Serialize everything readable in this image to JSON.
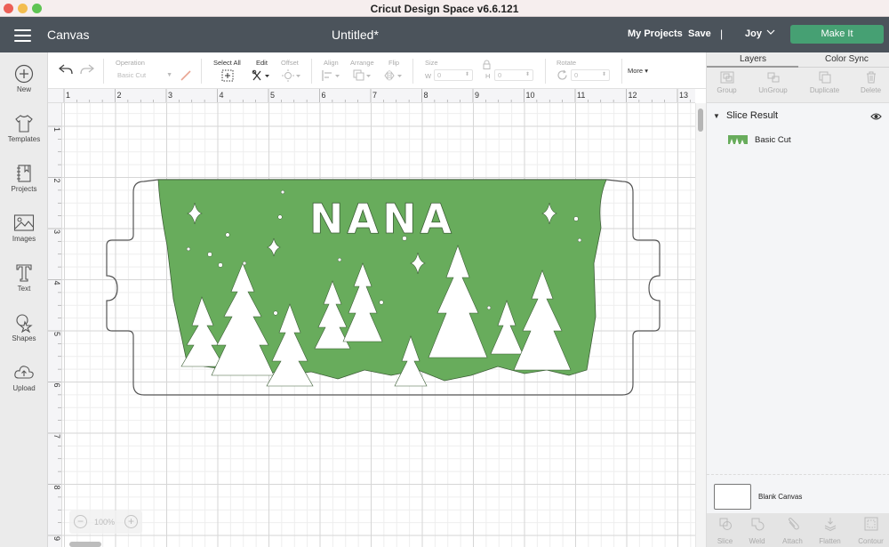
{
  "window": {
    "title": "Cricut Design Space  v6.6.121"
  },
  "header": {
    "section": "Canvas",
    "document_title": "Untitled*",
    "my_projects": "My Projects",
    "save": "Save",
    "separator": "|",
    "user": "Joy",
    "make_it": "Make It",
    "make_it_color": "#46a073"
  },
  "sidebar": {
    "items": [
      {
        "label": "New",
        "icon": "plus-circle-icon"
      },
      {
        "label": "Templates",
        "icon": "tshirt-icon"
      },
      {
        "label": "Projects",
        "icon": "notebook-icon"
      },
      {
        "label": "Images",
        "icon": "image-icon"
      },
      {
        "label": "Text",
        "icon": "text-t-icon"
      },
      {
        "label": "Shapes",
        "icon": "shapes-icon"
      },
      {
        "label": "Upload",
        "icon": "cloud-upload-icon"
      }
    ]
  },
  "toolbar": {
    "operation_label": "Operation",
    "operation_value": "Basic Cut",
    "select_all": "Select All",
    "edit": "Edit",
    "offset": "Offset",
    "align": "Align",
    "arrange": "Arrange",
    "flip": "Flip",
    "size": "Size",
    "w_label": "W",
    "w_value": "0",
    "h_label": "H",
    "h_value": "0",
    "rotate": "Rotate",
    "rotate_value": "0",
    "more": "More"
  },
  "rulers": {
    "horizontal": [
      "1",
      "2",
      "3",
      "4",
      "5",
      "6",
      "7",
      "8",
      "9",
      "10",
      "11",
      "12",
      "13"
    ],
    "vertical": [
      "1",
      "2",
      "3",
      "4",
      "5",
      "6",
      "7",
      "8",
      "9"
    ]
  },
  "canvas": {
    "design_text": "NANA",
    "design_fill": "#68ac5c",
    "zoom_level": "100%"
  },
  "right_panel": {
    "tabs": [
      "Layers",
      "Color Sync"
    ],
    "active_tab": "Layers",
    "actions": [
      "Group",
      "UnGroup",
      "Duplicate",
      "Delete"
    ],
    "layer_group": "Slice Result",
    "layer_item": "Basic Cut",
    "blank_canvas": "Blank Canvas",
    "bottom_actions": [
      "Slice",
      "Weld",
      "Attach",
      "Flatten",
      "Contour"
    ]
  }
}
